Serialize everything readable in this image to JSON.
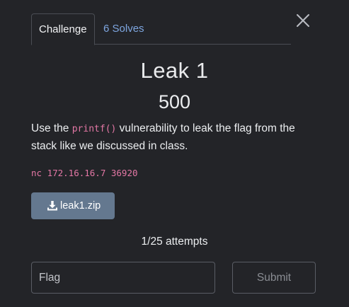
{
  "modal": {
    "close_icon": "close-icon"
  },
  "tabs": [
    {
      "label": "Challenge",
      "active": true
    },
    {
      "label": "6 Solves",
      "active": false
    }
  ],
  "challenge": {
    "title": "Leak 1",
    "points": "500",
    "description_before": "Use the ",
    "description_code": "printf()",
    "description_after": " vulnerability to leak the flag from the stack like we discussed in class.",
    "command": "nc 172.16.16.7 36920",
    "file_label": "leak1.zip",
    "file_icon": "download-icon",
    "attempts": "1/25 attempts"
  },
  "form": {
    "flag_placeholder": "Flag",
    "flag_value": "",
    "submit_label": "Submit"
  },
  "colors": {
    "background": "#232428",
    "link": "#7ea6e0",
    "code": "#e377a5",
    "download_button": "#64788f"
  }
}
